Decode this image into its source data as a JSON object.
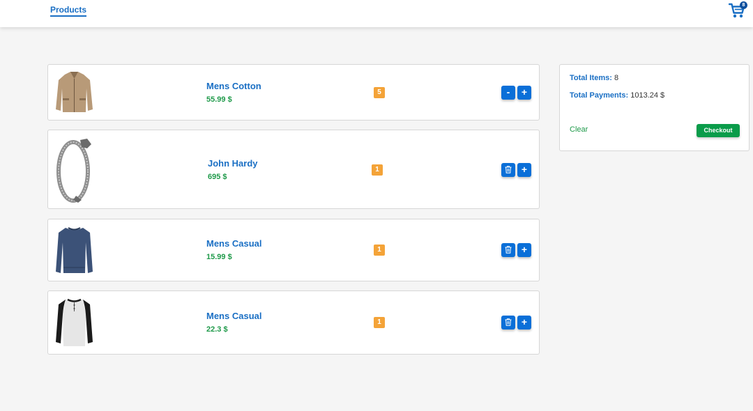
{
  "nav": {
    "products_label": "Products",
    "cart_count": "8"
  },
  "cart_items": [
    {
      "title": "Mens Cotton",
      "price": "55.99 $",
      "quantity": "5",
      "decrease_label": "-",
      "increase_label": "+",
      "image": "jacket-image"
    },
    {
      "title": "John Hardy",
      "price": "695 $",
      "quantity": "1",
      "increase_label": "+",
      "image": "bracelet-image"
    },
    {
      "title": "Mens Casual",
      "price": "15.99 $",
      "quantity": "1",
      "increase_label": "+",
      "image": "shirt-image"
    },
    {
      "title": "Mens Casual",
      "price": "22.3 $",
      "quantity": "1",
      "increase_label": "+",
      "image": "raglan-shirt-image"
    }
  ],
  "summary": {
    "total_items_label": "Total Items:",
    "total_items_value": "8",
    "total_payments_label": "Total Payments:",
    "total_payments_value": "1013.24 $",
    "clear_label": "Clear",
    "checkout_label": "Checkout"
  },
  "colors": {
    "accent": "#0a6fd8",
    "price": "#1f9a4a",
    "quantity": "#f4a338",
    "checkout": "#0a9c4a"
  }
}
